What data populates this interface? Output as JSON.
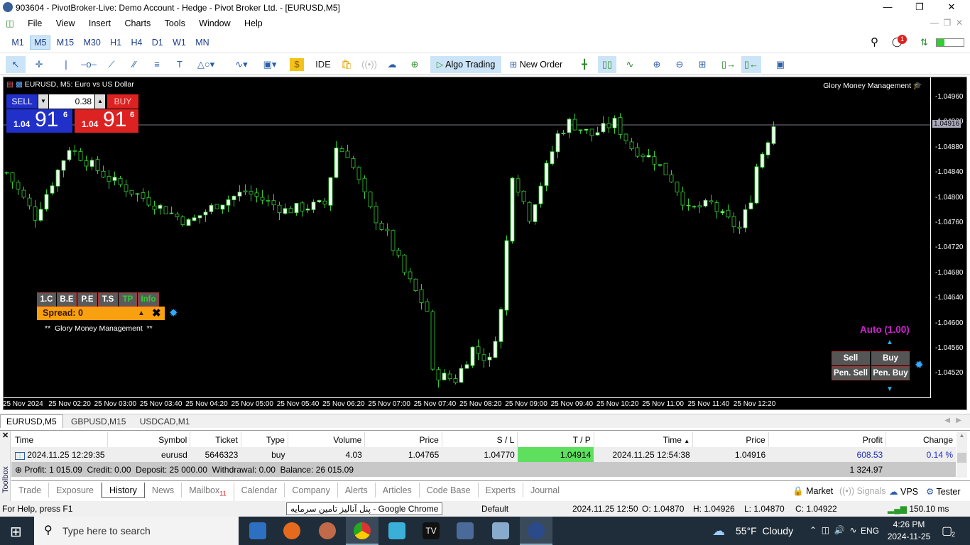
{
  "window": {
    "title": "903604 - PivotBroker-Live: Demo Account - Hedge - Pivot Broker Ltd. - [EURUSD,M5]"
  },
  "menu": [
    "File",
    "View",
    "Insert",
    "Charts",
    "Tools",
    "Window",
    "Help"
  ],
  "timeframes": [
    "M1",
    "M5",
    "M15",
    "M30",
    "H1",
    "H4",
    "D1",
    "W1",
    "MN"
  ],
  "active_timeframe": "M5",
  "notification_count": "1",
  "toolbar": {
    "ide": "IDE",
    "algo": "Algo Trading",
    "new_order": "New Order"
  },
  "chart": {
    "title": "EURUSD, M5:  Euro vs US Dollar",
    "indicator_name": "Glory Money Management",
    "one_click": {
      "sell": "SELL",
      "buy": "BUY",
      "volume": "0.38",
      "sell_big": "1.04",
      "sell_pips": "91",
      "sell_frac": "6",
      "buy_big": "1.04",
      "buy_pips": "91",
      "buy_frac": "6"
    },
    "panel": {
      "buttons": [
        "1.C",
        "B.E",
        "P.E",
        "T.S",
        "TP",
        "Info"
      ],
      "spread": "Spread: 0",
      "caption": "**  Glory Money Management  **"
    },
    "auto_label": "Auto (1.00)",
    "order_buttons": [
      "Sell",
      "Buy",
      "Pen. Sell",
      "Pen. Buy"
    ],
    "bid_label": "1.04916"
  },
  "chart_data": {
    "type": "candlestick",
    "symbol": "EURUSD",
    "timeframe": "M5",
    "ylim": [
      1.0449,
      1.0498
    ],
    "y_ticks": [
      "1.04960",
      "1.04920",
      "1.04880",
      "1.04840",
      "1.04800",
      "1.04760",
      "1.04720",
      "1.04680",
      "1.04640",
      "1.04600",
      "1.04560",
      "1.04520"
    ],
    "x_ticks": [
      "25 Nov 2024",
      "25 Nov 02:20",
      "25 Nov 03:00",
      "25 Nov 03:40",
      "25 Nov 04:20",
      "25 Nov 05:00",
      "25 Nov 05:40",
      "25 Nov 06:20",
      "25 Nov 07:00",
      "25 Nov 07:40",
      "25 Nov 08:20",
      "25 Nov 09:00",
      "25 Nov 09:40",
      "25 Nov 10:20",
      "25 Nov 11:00",
      "25 Nov 11:40",
      "25 Nov 12:20"
    ],
    "bid": 1.04916,
    "price_path": [
      [
        "01:40",
        1.0484
      ],
      [
        "02:05",
        1.0477
      ],
      [
        "02:35",
        1.0488
      ],
      [
        "03:10",
        1.0483
      ],
      [
        "03:40",
        1.048
      ],
      [
        "04:20",
        1.0476
      ],
      [
        "04:45",
        1.0479
      ],
      [
        "05:10",
        1.0481
      ],
      [
        "05:45",
        1.0478
      ],
      [
        "06:20",
        1.0479
      ],
      [
        "06:30",
        1.0488
      ],
      [
        "06:40",
        1.0487
      ],
      [
        "07:00",
        1.0478
      ],
      [
        "07:15",
        1.0474
      ],
      [
        "07:30",
        1.0468
      ],
      [
        "07:50",
        1.0462
      ],
      [
        "07:55",
        1.0452
      ],
      [
        "08:15",
        1.0451
      ],
      [
        "08:30",
        1.0456
      ],
      [
        "08:45",
        1.0454
      ],
      [
        "08:55",
        1.0462
      ],
      [
        "09:05",
        1.0484
      ],
      [
        "09:20",
        1.0477
      ],
      [
        "09:45",
        1.049
      ],
      [
        "09:55",
        1.0492
      ],
      [
        "10:15",
        1.049
      ],
      [
        "10:35",
        1.0492
      ],
      [
        "10:50",
        1.0488
      ],
      [
        "11:10",
        1.0486
      ],
      [
        "11:25",
        1.0483
      ],
      [
        "11:40",
        1.0478
      ],
      [
        "12:00",
        1.0479
      ],
      [
        "12:10",
        1.0477
      ],
      [
        "12:25",
        1.0475
      ],
      [
        "12:35",
        1.048
      ],
      [
        "12:40",
        1.0485
      ],
      [
        "12:55",
        1.04916
      ]
    ]
  },
  "chart_tabs": [
    "EURUSD,M5",
    "GBPUSD,M15",
    "USDCAD,M1"
  ],
  "history": {
    "columns": [
      "Time",
      "Symbol",
      "Ticket",
      "Type",
      "Volume",
      "Price",
      "S / L",
      "T / P",
      "Time",
      "Price",
      "Profit",
      "Change"
    ],
    "rows": [
      [
        "2024.11.25 12:29:35",
        "eurusd",
        "5646323",
        "buy",
        "4.03",
        "1.04765",
        "1.04770",
        "1.04914",
        "2024.11.25 12:54:38",
        "1.04916",
        "608.53",
        "0.14 %"
      ]
    ],
    "summary": "Profit: 1 015.09  Credit: 0.00  Deposit: 25 000.00  Withdrawal: 0.00  Balance: 26 015.09",
    "summary_total": "1 324.97"
  },
  "toolbox_label": "Toolbox",
  "bottom_tabs": [
    "Trade",
    "Exposure",
    "History",
    "News",
    "Mailbox",
    "Calendar",
    "Company",
    "Alerts",
    "Articles",
    "Code Base",
    "Experts",
    "Journal"
  ],
  "mailbox_count": "11",
  "bottom_right": [
    "Market",
    "Signals",
    "VPS",
    "Tester"
  ],
  "status": {
    "help": "For Help, press F1",
    "tooltip": "پنل آنالیز تامین سرمایه - Google Chrome",
    "profile": "Default",
    "time": "2024.11.25 12:50",
    "o": "O: 1.04870",
    "h": "H: 1.04926",
    "l": "L: 1.04870",
    "c": "C: 1.04922",
    "ping": "150.10 ms"
  },
  "taskbar": {
    "search": "Type here to search",
    "weather": "55°F  Cloudy",
    "lang": "ENG",
    "clock_time": "4:26 PM",
    "clock_date": "2024-11-25",
    "notif": "2"
  }
}
